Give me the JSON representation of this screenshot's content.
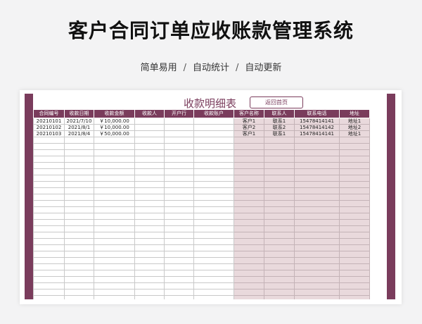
{
  "page": {
    "title": "客户合同订单应收账款管理系统",
    "subtitle_parts": [
      "简单易用",
      "自动统计",
      "自动更新"
    ],
    "separator": "/"
  },
  "sheet": {
    "title": "收款明细表",
    "home_button": "返回首页",
    "colors": {
      "frame": "#7a3c5c",
      "header_bg": "#7a3c5c",
      "shaded_columns": "#e9d9dc"
    },
    "columns": [
      "合同编号",
      "收款日期",
      "收款金额",
      "收款人",
      "开户行",
      "收款账户",
      "客户名称",
      "联系人",
      "联系电话",
      "地址"
    ],
    "rows": [
      [
        "20210101",
        "2021/7/10",
        "￥10,000.00",
        "",
        "",
        "",
        "客户1",
        "联系1",
        "15478414141",
        "地址1"
      ],
      [
        "20210102",
        "2021/8/1",
        "￥10,000.00",
        "",
        "",
        "",
        "客户2",
        "联系2",
        "15478414142",
        "地址2"
      ],
      [
        "20210103",
        "2021/8/4",
        "￥50,000.00",
        "",
        "",
        "",
        "客户1",
        "联系1",
        "15478414141",
        "地址1"
      ]
    ],
    "empty_rows": 26
  }
}
